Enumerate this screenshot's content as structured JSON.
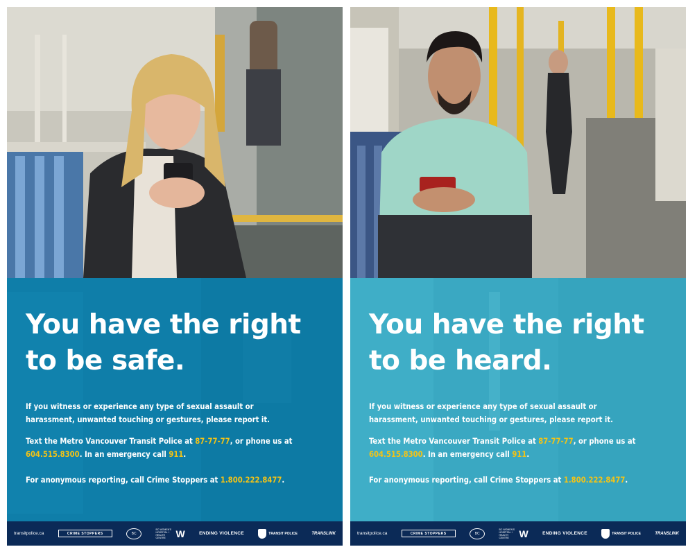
{
  "posters": [
    {
      "headline_line1": "You have the right",
      "headline_line2": "to be safe.",
      "para1_line1": "If you witness or experience any type of sexual assault or",
      "para1_line2": "harassment, unwanted touching or gestures, please report it.",
      "para2_pre": "Text the Metro Vancouver Transit Police at ",
      "para2_text_number": "87-77-77",
      "para2_mid": ", or phone us at",
      "para2_phone": "604.515.8300",
      "para2_emergency": ". In an emergency call ",
      "para2_911": "911",
      "para2_end": ".",
      "para3_pre": "For anonymous reporting, call Crime Stoppers at ",
      "para3_phone": "1.800.222.8477",
      "para3_end": ".",
      "footer_url": "transitpolice.ca",
      "logo_crime_stoppers": "CRIME STOPPERS",
      "logo_bc": "BC",
      "logo_w": "W",
      "logo_w_small": "BC WOMEN'S HOSPITAL + HEALTH CENTRE",
      "logo_ending_violence": "ENDING VIOLENCE",
      "logo_transit_police": "TRANSIT POLICE",
      "logo_translink": "TRANSLINK"
    },
    {
      "headline_line1": "You have the right",
      "headline_line2": "to be heard.",
      "para1_line1": "If you witness or experience any type of sexual assault or",
      "para1_line2": "harassment, unwanted touching or gestures, please report it.",
      "para2_pre": "Text the Metro Vancouver Transit Police at ",
      "para2_text_number": "87-77-77",
      "para2_mid": ", or phone us at",
      "para2_phone": "604.515.8300",
      "para2_emergency": ". In an emergency call ",
      "para2_911": "911",
      "para2_end": ".",
      "para3_pre": "For anonymous reporting, call Crime Stoppers at ",
      "para3_phone": "1.800.222.8477",
      "para3_end": ".",
      "footer_url": "transitpolice.ca",
      "logo_crime_stoppers": "CRIME STOPPERS",
      "logo_bc": "BC",
      "logo_w": "W",
      "logo_w_small": "BC WOMEN'S HOSPITAL + HEALTH CENTRE",
      "logo_ending_violence": "ENDING VIOLENCE",
      "logo_transit_police": "TRANSIT POLICE",
      "logo_translink": "TRANSLINK"
    }
  ],
  "colors": {
    "panel_left": "#0f7ea9",
    "panel_right": "#3aa8c2",
    "highlight": "#f3c316",
    "footer": "#0b2a57",
    "headline": "#ffffff"
  }
}
